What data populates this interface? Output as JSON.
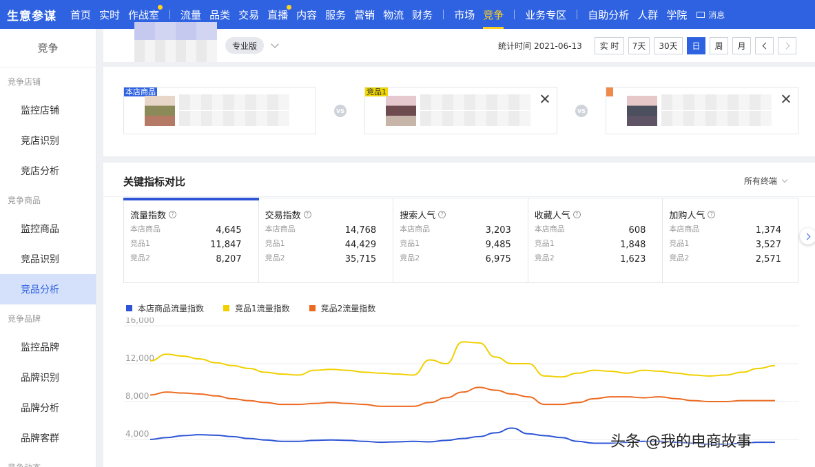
{
  "topnav": {
    "logo": "生意参谋",
    "group1": [
      "首页",
      "实时",
      "作战室"
    ],
    "group2": [
      "流量",
      "品类",
      "交易",
      "直播",
      "内容",
      "服务",
      "营销",
      "物流",
      "财务"
    ],
    "group3": [
      "市场",
      "竞争"
    ],
    "group4": [
      "业务专区"
    ],
    "group5": [
      "自助分析",
      "人群",
      "学院"
    ],
    "message": "消息",
    "active": "竞争",
    "accent": "#2e62e0",
    "highlight": "#ffd21e"
  },
  "sidebar": {
    "title": "竞争",
    "sections": [
      {
        "label": "竞争店铺",
        "items": [
          "监控店铺",
          "竞店识别",
          "竞店分析"
        ]
      },
      {
        "label": "竞争商品",
        "items": [
          "监控商品",
          "竞品识别",
          "竞品分析"
        ]
      },
      {
        "label": "竞争品牌",
        "items": [
          "监控品牌",
          "品牌识别",
          "品牌分析",
          "品牌客群"
        ]
      },
      {
        "label": "竞争动态",
        "items": []
      }
    ],
    "active": "竞品分析"
  },
  "header": {
    "edition": "专业版",
    "stat_label": "统计时间",
    "stat_date": "2021-06-13",
    "periods": [
      "实 时",
      "7天",
      "30天",
      "日",
      "周",
      "月"
    ],
    "active_period": "日"
  },
  "compare": {
    "products": [
      {
        "tag": "本店商品",
        "color": "#2e62e0"
      },
      {
        "tag": "竞品1",
        "color": "#f1d800"
      },
      {
        "tag": "",
        "color": "#f08a4b"
      }
    ],
    "vs": "VS"
  },
  "metrics": {
    "title": "关键指标对比",
    "terminal": "所有终端",
    "row_labels": [
      "本店商品",
      "竞品1",
      "竞品2"
    ],
    "kpis": [
      {
        "name": "流量指数",
        "values": [
          "4,645",
          "11,847",
          "8,207"
        ]
      },
      {
        "name": "交易指数",
        "values": [
          "14,768",
          "44,429",
          "35,715"
        ]
      },
      {
        "name": "搜索人气",
        "values": [
          "3,203",
          "9,485",
          "6,975"
        ]
      },
      {
        "name": "收藏人气",
        "values": [
          "608",
          "1,848",
          "1,623"
        ]
      },
      {
        "name": "加购人气",
        "values": [
          "1,374",
          "3,527",
          "2,571"
        ]
      }
    ],
    "active_kpi": "流量指数"
  },
  "chart_data": {
    "type": "line",
    "ylim": [
      0,
      16000
    ],
    "yticks": [
      "16,000",
      "12,000",
      "8,000",
      "4,000"
    ],
    "grid": true,
    "legend_position": "top-left",
    "x": [
      1,
      2,
      3,
      4,
      5,
      6,
      7,
      8,
      9,
      10,
      11,
      12,
      13,
      14,
      15,
      16,
      17,
      18,
      19,
      20,
      21,
      22,
      23,
      24,
      25,
      26,
      27,
      28,
      29,
      30,
      31,
      32,
      33,
      34,
      35,
      36,
      37,
      38,
      39
    ],
    "series": [
      {
        "name": "本店商品流量指数",
        "color": "#2e55d6",
        "values": [
          4000,
          4200,
          4400,
          4500,
          4450,
          4300,
          4100,
          3950,
          3800,
          3800,
          3900,
          3950,
          3900,
          3800,
          3700,
          3750,
          3800,
          3750,
          3900,
          4100,
          4300,
          4700,
          5200,
          4600,
          4400,
          4200,
          3800,
          3600,
          3600,
          3700,
          3800,
          3800,
          3700,
          3600,
          3500,
          3500,
          3600,
          3700,
          3700
        ]
      },
      {
        "name": "竞品1流量指数",
        "color": "#f0d000",
        "values": [
          12300,
          13000,
          12800,
          12500,
          12100,
          11800,
          11500,
          11100,
          10900,
          10800,
          11300,
          11400,
          11300,
          11100,
          11000,
          10900,
          10800,
          12400,
          12000,
          14300,
          14200,
          12700,
          12000,
          12000,
          10700,
          10600,
          11000,
          11300,
          11200,
          11000,
          11300,
          11200,
          11000,
          10800,
          10700,
          10800,
          11100,
          11500,
          11800
        ]
      },
      {
        "name": "竞品2流量指数",
        "color": "#ec6a20",
        "values": [
          8700,
          9000,
          8900,
          8800,
          8600,
          8300,
          8100,
          7900,
          7700,
          7700,
          7800,
          7900,
          7800,
          7700,
          7500,
          7500,
          7500,
          7900,
          8400,
          9000,
          9500,
          9200,
          8800,
          8500,
          7700,
          7700,
          7900,
          8300,
          8500,
          8500,
          8400,
          8500,
          8300,
          8100,
          8000,
          8000,
          8100,
          8100,
          8100
        ]
      }
    ]
  },
  "watermark": "头条 @我的电商故事"
}
